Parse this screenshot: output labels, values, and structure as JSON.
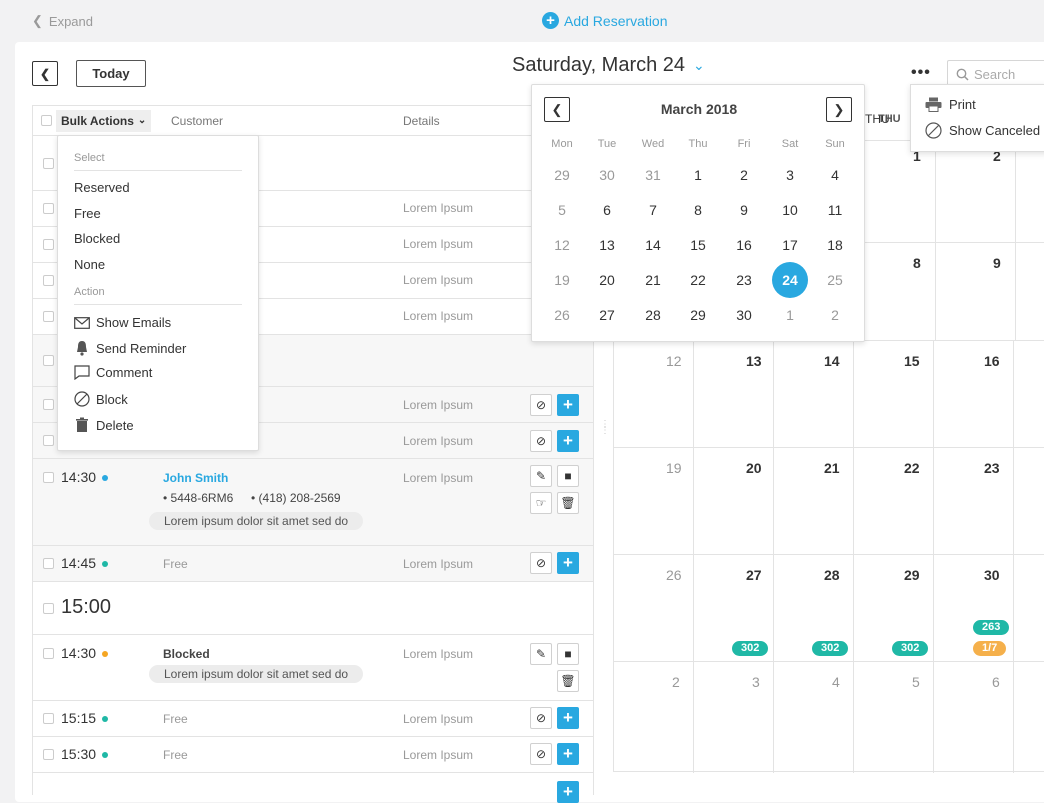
{
  "top": {
    "expand_label": "Expand",
    "add_reservation_label": "Add Reservation"
  },
  "toolbar": {
    "today_label": "Today",
    "date_title": "Saturday, March 24",
    "search_placeholder": "Search"
  },
  "more_menu": {
    "print_label": "Print",
    "show_canceled_label": "Show Canceled"
  },
  "list": {
    "columns": {
      "bulk_actions": "Bulk Actions",
      "customer": "Customer",
      "details": "Details"
    },
    "lorem": "Lorem Ipsum",
    "rows": [
      {
        "time": "14:30",
        "name": "John Smith",
        "code": "• 5448-6RM6",
        "phone": "• (418) 208-2569",
        "note": "Lorem ipsum dolor sit amet sed do",
        "details": "Lorem Ipsum"
      },
      {
        "time": "14:45",
        "status": "Free",
        "details": "Lorem Ipsum"
      },
      {
        "section_time": "15:00"
      },
      {
        "time": "14:30",
        "status": "Blocked",
        "note": "Lorem ipsum dolor sit amet sed do",
        "details": "Lorem Ipsum"
      },
      {
        "time": "15:15",
        "status": "Free",
        "details": "Lorem Ipsum"
      },
      {
        "time": "15:30",
        "status": "Free",
        "details": "Lorem Ipsum"
      }
    ]
  },
  "bulk_menu": {
    "select_heading": "Select",
    "select_items": [
      "Reserved",
      "Free",
      "Blocked",
      "None"
    ],
    "action_heading": "Action",
    "action_items": [
      "Show Emails",
      "Send Reminder",
      "Comment",
      "Block",
      "Delete"
    ]
  },
  "mini_calendar": {
    "month_label": "March 2018",
    "weekdays": [
      "Mon",
      "Tue",
      "Wed",
      "Thu",
      "Fri",
      "Sat",
      "Sun"
    ],
    "weeks": [
      [
        "29",
        "30",
        "31",
        "1",
        "2",
        "3",
        "4"
      ],
      [
        "5",
        "6",
        "7",
        "8",
        "9",
        "10",
        "11"
      ],
      [
        "12",
        "13",
        "14",
        "15",
        "16",
        "17",
        "18"
      ],
      [
        "19",
        "20",
        "21",
        "22",
        "23",
        "24",
        "25"
      ],
      [
        "26",
        "27",
        "28",
        "29",
        "30",
        "1",
        "2"
      ]
    ],
    "selected": "24"
  },
  "month_grid": {
    "header_thu": "THU",
    "row0": [
      "1",
      "2"
    ],
    "row1": [
      "8",
      "9"
    ],
    "rows": [
      [
        "12",
        "13",
        "14",
        "15",
        "16"
      ],
      [
        "19",
        "20",
        "21",
        "22",
        "23"
      ],
      [
        "26",
        "27",
        "28",
        "29",
        "30"
      ],
      [
        "2",
        "3",
        "4",
        "5",
        "6"
      ]
    ],
    "badges": {
      "b27": "302",
      "b28": "302",
      "b29": "302",
      "b30a": "263",
      "b30b": "1/7"
    }
  },
  "colors": {
    "accent": "#29a8e0",
    "teal": "#1fb8a6",
    "orange": "#f5a623"
  }
}
